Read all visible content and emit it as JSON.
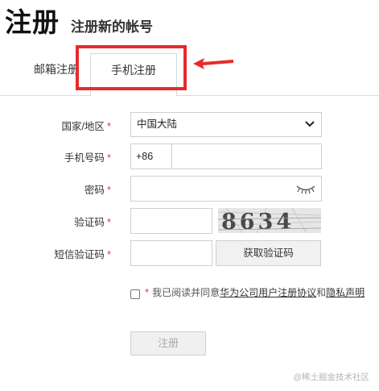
{
  "header": {
    "title": "注册",
    "subtitle": "注册新的帐号"
  },
  "tabs": [
    {
      "label": "邮箱注册",
      "active": false
    },
    {
      "label": "手机注册",
      "active": true
    }
  ],
  "form": {
    "region": {
      "label": "国家/地区",
      "required_mark": "*",
      "value": "中国大陆"
    },
    "phone": {
      "label": "手机号码",
      "required_mark": "*",
      "country_code": "+86",
      "value": ""
    },
    "password": {
      "label": "密码",
      "required_mark": "*",
      "value": ""
    },
    "captcha": {
      "label": "验证码",
      "required_mark": "*",
      "value": "",
      "image_text": "8634"
    },
    "sms_code": {
      "label": "短信验证码",
      "required_mark": "*",
      "value": "",
      "button_label": "获取验证码"
    },
    "agreement": {
      "required_mark": "*",
      "prefix": "我已阅读并同意",
      "link1": "华为公司用户注册协议",
      "middle": "和",
      "link2": "隐私声明",
      "checked": false
    },
    "submit_label": "注册"
  },
  "watermark": "@稀土掘金技术社区",
  "colors": {
    "required": "#e23a3a",
    "highlight_box": "#e52b2b"
  }
}
